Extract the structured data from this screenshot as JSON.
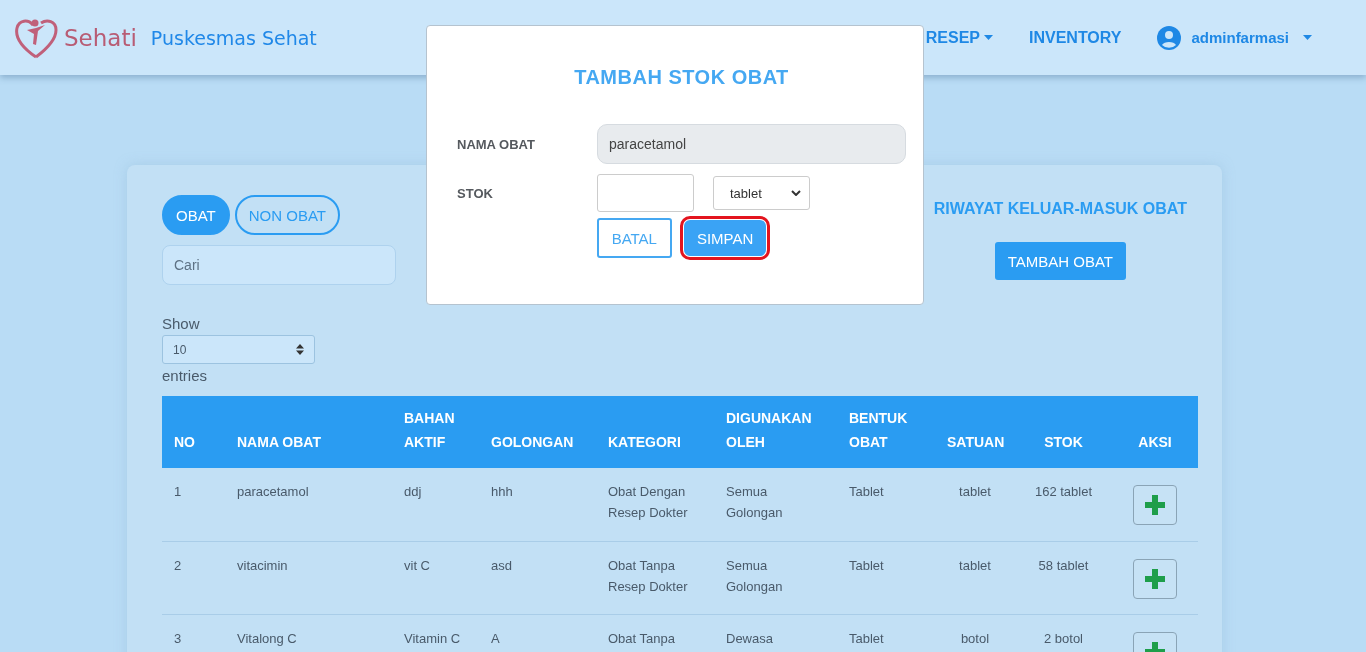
{
  "header": {
    "logo_text": "Sehati",
    "brand": "Puskesmas Sehat",
    "nav": [
      {
        "label": "RESEP",
        "dropdown": true
      },
      {
        "label": "INVENTORY",
        "dropdown": false
      }
    ],
    "user": {
      "name": "adminfarmasi"
    }
  },
  "filter_tabs": [
    {
      "label": "OBAT",
      "selected": true
    },
    {
      "label": "NON OBAT",
      "selected": false
    }
  ],
  "search": {
    "placeholder": "Cari"
  },
  "history_link": "RIWAYAT KELUAR-MASUK OBAT",
  "add_button": "TAMBAH OBAT",
  "page_length": {
    "label_before": "Show",
    "value": "10",
    "label_after": "entries"
  },
  "table": {
    "columns": [
      "NO",
      "NAMA OBAT",
      "BAHAN AKTIF",
      "GOLONGAN",
      "KATEGORI",
      "DIGUNAKAN OLEH",
      "BENTUK OBAT",
      "SATUAN",
      "STOK",
      "AKSI"
    ],
    "rows": [
      {
        "cells": [
          "1",
          "paracetamol",
          "ddj",
          "hhh",
          "Obat Dengan Resep Dokter",
          "Semua Golongan",
          "Tablet",
          "tablet",
          "162 tablet"
        ]
      },
      {
        "cells": [
          "2",
          "vitacimin",
          "vit C",
          "asd",
          "Obat Tanpa Resep Dokter",
          "Semua Golongan",
          "Tablet",
          "tablet",
          "58 tablet"
        ]
      },
      {
        "cells": [
          "3",
          "Vitalong C",
          "Vitamin C",
          "A",
          "Obat Tanpa",
          "Dewasa",
          "Tablet",
          "botol",
          "2 botol"
        ]
      }
    ]
  },
  "modal": {
    "title": "TAMBAH STOK OBAT",
    "name_label": "NAMA OBAT",
    "name_value": "paracetamol",
    "stock_label": "STOK",
    "unit_value": "tablet",
    "buttons": [
      {
        "label": "BATAL",
        "kind": "outline",
        "highlighted": false
      },
      {
        "label": "SIMPAN",
        "kind": "primary",
        "highlighted": true
      }
    ]
  }
}
